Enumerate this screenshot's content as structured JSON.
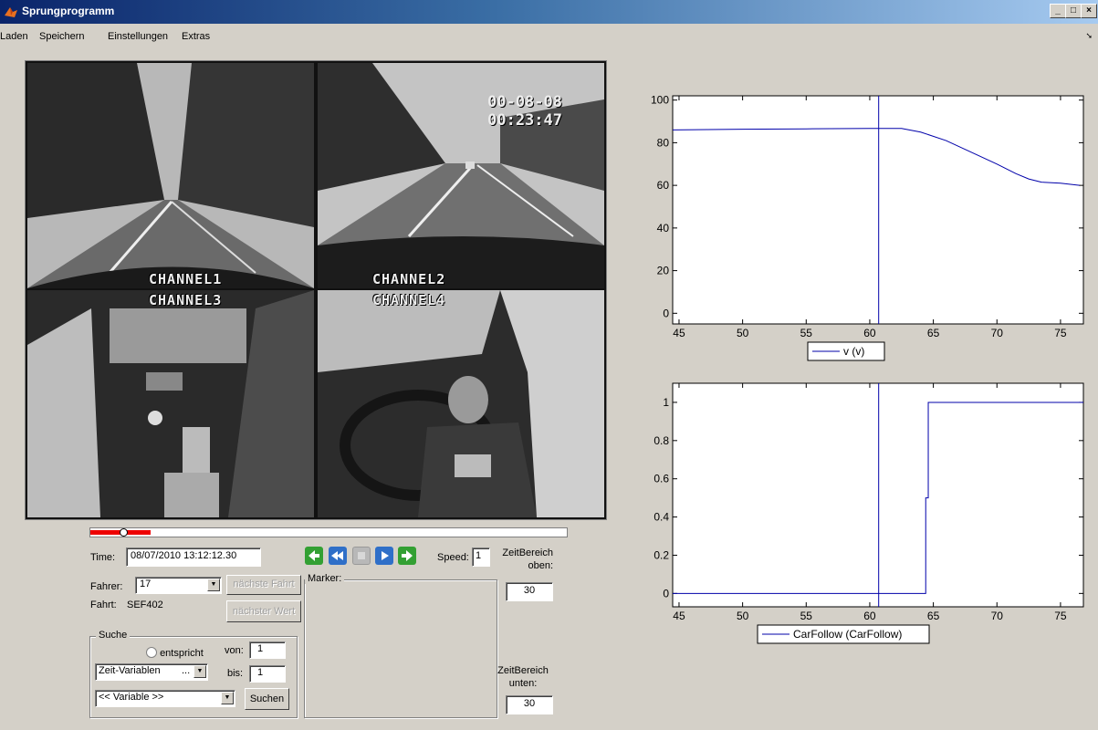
{
  "window": {
    "title": "Sprungprogramm"
  },
  "menu": {
    "items": [
      "Laden",
      "Speichern",
      "Einstellungen",
      "Extras"
    ]
  },
  "video": {
    "channels": [
      "CHANNEL1",
      "CHANNEL2",
      "CHANNEL3",
      "CHANNEL4"
    ],
    "osd_line1": "00-08-08",
    "osd_line2": "00:23:47",
    "progress": 0.127
  },
  "controls": {
    "time_label": "Time:",
    "time_value": "08/07/2010 13:12:12.30",
    "speed_label": "Speed:",
    "speed_value": "1",
    "zeitbereich_oben_label": "ZeitBereich oben:",
    "zeitbereich_oben_value": "30",
    "zeitbereich_unten_label": "ZeitBereich unten:",
    "zeitbereich_unten_value": "30",
    "fahrer_label": "Fahrer:",
    "fahrer_value": "17",
    "naechste_fahrt": "nächste Fahrt",
    "naechster_wert": "nächster Wert",
    "fahrt_label": "Fahrt:",
    "fahrt_value": "SEF402",
    "marker_label": "Marker:",
    "media_icons": [
      "prev-arrow-icon",
      "rewind-icon",
      "stop-icon",
      "play-icon",
      "next-arrow-icon"
    ]
  },
  "suche": {
    "legend": "Suche",
    "radio_label": "entspricht",
    "von_label": "von:",
    "von_value": "1",
    "bis_label": "bis:",
    "bis_value": "1",
    "zeit_variablen": "Zeit-Variablen",
    "zeit_variablen_more": "...",
    "variable": "<< Variable >>",
    "suchen": "Suchen"
  },
  "chart_data": [
    {
      "type": "line",
      "series": [
        {
          "name": "v (v)",
          "color": "#0000aa",
          "x": [
            44.5,
            50,
            55,
            60,
            62.5,
            64,
            66,
            68,
            70,
            71.5,
            72.5,
            73.5,
            75,
            76.5
          ],
          "y": [
            86,
            86.3,
            86.5,
            86.7,
            86.7,
            85,
            81,
            75.5,
            70,
            65.5,
            63,
            61.5,
            61,
            60
          ]
        }
      ],
      "xlim": [
        44.5,
        76.8
      ],
      "ylim": [
        -5,
        102
      ],
      "xticks": [
        45,
        50,
        55,
        60,
        65,
        70,
        75
      ],
      "yticks": [
        0,
        20,
        40,
        60,
        80,
        100
      ],
      "cursor_x": 60.7,
      "legend": "bottom-center"
    },
    {
      "type": "line",
      "series": [
        {
          "name": "CarFollow (CarFollow)",
          "color": "#0000aa",
          "x": [
            44.5,
            64.4,
            64.4,
            64.6,
            64.6,
            76.8
          ],
          "y": [
            0,
            0,
            0.5,
            0.5,
            1,
            1
          ]
        }
      ],
      "xlim": [
        44.5,
        76.8
      ],
      "ylim": [
        -0.07,
        1.1
      ],
      "xticks": [
        45,
        50,
        55,
        60,
        65,
        70,
        75
      ],
      "yticks": [
        0,
        0.2,
        0.4,
        0.6,
        0.8,
        1
      ],
      "cursor_x": 60.7,
      "legend": "bottom-center"
    }
  ]
}
